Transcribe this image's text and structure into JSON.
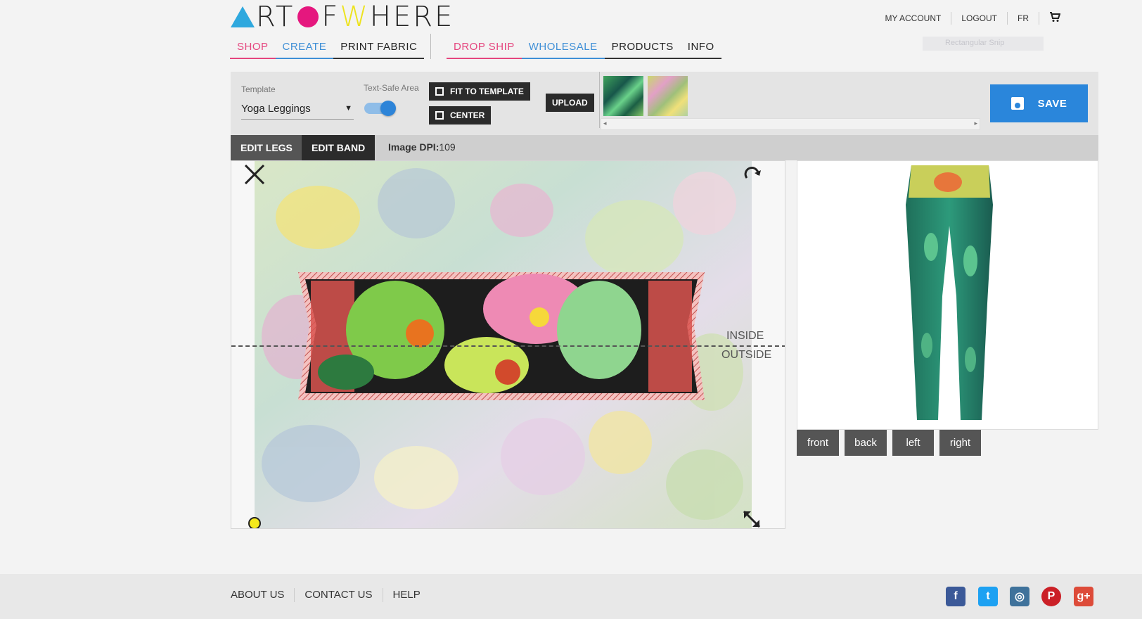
{
  "brand": {
    "logo_parts": [
      "RT ",
      "F ",
      "HERE"
    ],
    "logo_alt": "ART OF WHERE",
    "colors": {
      "cyan": "#2ea8de",
      "magenta": "#e5177e",
      "yellow": "#ede31f"
    }
  },
  "nav_left": [
    {
      "label": "SHOP",
      "style": "pink"
    },
    {
      "label": "CREATE",
      "style": "blue"
    },
    {
      "label": "PRINT FABRIC",
      "style": "dark"
    }
  ],
  "nav_right": [
    {
      "label": "DROP SHIP",
      "style": "pink"
    },
    {
      "label": "WHOLESALE",
      "style": "blue"
    },
    {
      "label": "PRODUCTS",
      "style": "dark"
    },
    {
      "label": "INFO",
      "style": "dark"
    }
  ],
  "top_links": {
    "account": "MY ACCOUNT",
    "logout": "LOGOUT",
    "lang": "FR",
    "cart_icon": "cart-icon"
  },
  "overlay": {
    "snip": "Rectangular Snip"
  },
  "toolbar": {
    "template_label": "Template",
    "template_value": "Yoga Leggings",
    "text_safe_label": "Text-Safe Area",
    "text_safe_on": true,
    "fit_label": "FIT TO TEMPLATE",
    "center_label": "CENTER",
    "upload_label": "UPLOAD",
    "save_label": "SAVE"
  },
  "tabs": {
    "legs": "EDIT LEGS",
    "band": "EDIT BAND"
  },
  "dpi": {
    "label": "Image DPI:",
    "value": "109"
  },
  "canvas": {
    "inside_label": "INSIDE",
    "outside_label": "OUTSIDE"
  },
  "preview": {
    "views": [
      "front",
      "back",
      "left",
      "right"
    ]
  },
  "footer": {
    "links": [
      "ABOUT US",
      "CONTACT US",
      "HELP"
    ]
  },
  "social": [
    {
      "icon": "facebook-icon",
      "glyph": "f",
      "color": "#3b5998"
    },
    {
      "icon": "twitter-icon",
      "glyph": "t",
      "color": "#1da1f2"
    },
    {
      "icon": "instagram-icon",
      "glyph": "◎",
      "color": "#3f729b"
    },
    {
      "icon": "pinterest-icon",
      "glyph": "P",
      "color": "#cb2027"
    },
    {
      "icon": "googleplus-icon",
      "glyph": "g+",
      "color": "#dd4b39"
    }
  ]
}
